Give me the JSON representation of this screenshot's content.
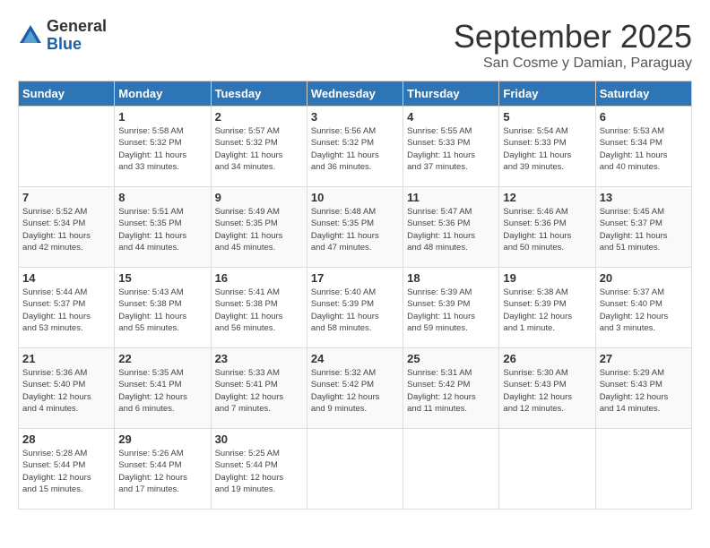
{
  "header": {
    "logo_general": "General",
    "logo_blue": "Blue",
    "month": "September 2025",
    "location": "San Cosme y Damian, Paraguay"
  },
  "days_of_week": [
    "Sunday",
    "Monday",
    "Tuesday",
    "Wednesday",
    "Thursday",
    "Friday",
    "Saturday"
  ],
  "weeks": [
    [
      {
        "day": "",
        "info": ""
      },
      {
        "day": "1",
        "info": "Sunrise: 5:58 AM\nSunset: 5:32 PM\nDaylight: 11 hours\nand 33 minutes."
      },
      {
        "day": "2",
        "info": "Sunrise: 5:57 AM\nSunset: 5:32 PM\nDaylight: 11 hours\nand 34 minutes."
      },
      {
        "day": "3",
        "info": "Sunrise: 5:56 AM\nSunset: 5:32 PM\nDaylight: 11 hours\nand 36 minutes."
      },
      {
        "day": "4",
        "info": "Sunrise: 5:55 AM\nSunset: 5:33 PM\nDaylight: 11 hours\nand 37 minutes."
      },
      {
        "day": "5",
        "info": "Sunrise: 5:54 AM\nSunset: 5:33 PM\nDaylight: 11 hours\nand 39 minutes."
      },
      {
        "day": "6",
        "info": "Sunrise: 5:53 AM\nSunset: 5:34 PM\nDaylight: 11 hours\nand 40 minutes."
      }
    ],
    [
      {
        "day": "7",
        "info": "Sunrise: 5:52 AM\nSunset: 5:34 PM\nDaylight: 11 hours\nand 42 minutes."
      },
      {
        "day": "8",
        "info": "Sunrise: 5:51 AM\nSunset: 5:35 PM\nDaylight: 11 hours\nand 44 minutes."
      },
      {
        "day": "9",
        "info": "Sunrise: 5:49 AM\nSunset: 5:35 PM\nDaylight: 11 hours\nand 45 minutes."
      },
      {
        "day": "10",
        "info": "Sunrise: 5:48 AM\nSunset: 5:35 PM\nDaylight: 11 hours\nand 47 minutes."
      },
      {
        "day": "11",
        "info": "Sunrise: 5:47 AM\nSunset: 5:36 PM\nDaylight: 11 hours\nand 48 minutes."
      },
      {
        "day": "12",
        "info": "Sunrise: 5:46 AM\nSunset: 5:36 PM\nDaylight: 11 hours\nand 50 minutes."
      },
      {
        "day": "13",
        "info": "Sunrise: 5:45 AM\nSunset: 5:37 PM\nDaylight: 11 hours\nand 51 minutes."
      }
    ],
    [
      {
        "day": "14",
        "info": "Sunrise: 5:44 AM\nSunset: 5:37 PM\nDaylight: 11 hours\nand 53 minutes."
      },
      {
        "day": "15",
        "info": "Sunrise: 5:43 AM\nSunset: 5:38 PM\nDaylight: 11 hours\nand 55 minutes."
      },
      {
        "day": "16",
        "info": "Sunrise: 5:41 AM\nSunset: 5:38 PM\nDaylight: 11 hours\nand 56 minutes."
      },
      {
        "day": "17",
        "info": "Sunrise: 5:40 AM\nSunset: 5:39 PM\nDaylight: 11 hours\nand 58 minutes."
      },
      {
        "day": "18",
        "info": "Sunrise: 5:39 AM\nSunset: 5:39 PM\nDaylight: 11 hours\nand 59 minutes."
      },
      {
        "day": "19",
        "info": "Sunrise: 5:38 AM\nSunset: 5:39 PM\nDaylight: 12 hours\nand 1 minute."
      },
      {
        "day": "20",
        "info": "Sunrise: 5:37 AM\nSunset: 5:40 PM\nDaylight: 12 hours\nand 3 minutes."
      }
    ],
    [
      {
        "day": "21",
        "info": "Sunrise: 5:36 AM\nSunset: 5:40 PM\nDaylight: 12 hours\nand 4 minutes."
      },
      {
        "day": "22",
        "info": "Sunrise: 5:35 AM\nSunset: 5:41 PM\nDaylight: 12 hours\nand 6 minutes."
      },
      {
        "day": "23",
        "info": "Sunrise: 5:33 AM\nSunset: 5:41 PM\nDaylight: 12 hours\nand 7 minutes."
      },
      {
        "day": "24",
        "info": "Sunrise: 5:32 AM\nSunset: 5:42 PM\nDaylight: 12 hours\nand 9 minutes."
      },
      {
        "day": "25",
        "info": "Sunrise: 5:31 AM\nSunset: 5:42 PM\nDaylight: 12 hours\nand 11 minutes."
      },
      {
        "day": "26",
        "info": "Sunrise: 5:30 AM\nSunset: 5:43 PM\nDaylight: 12 hours\nand 12 minutes."
      },
      {
        "day": "27",
        "info": "Sunrise: 5:29 AM\nSunset: 5:43 PM\nDaylight: 12 hours\nand 14 minutes."
      }
    ],
    [
      {
        "day": "28",
        "info": "Sunrise: 5:28 AM\nSunset: 5:44 PM\nDaylight: 12 hours\nand 15 minutes."
      },
      {
        "day": "29",
        "info": "Sunrise: 5:26 AM\nSunset: 5:44 PM\nDaylight: 12 hours\nand 17 minutes."
      },
      {
        "day": "30",
        "info": "Sunrise: 5:25 AM\nSunset: 5:44 PM\nDaylight: 12 hours\nand 19 minutes."
      },
      {
        "day": "",
        "info": ""
      },
      {
        "day": "",
        "info": ""
      },
      {
        "day": "",
        "info": ""
      },
      {
        "day": "",
        "info": ""
      }
    ]
  ]
}
